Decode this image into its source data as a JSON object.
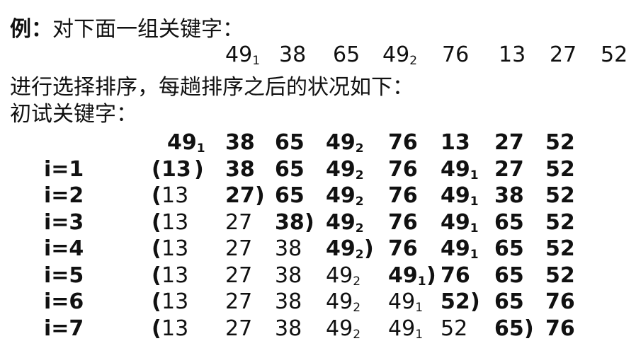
{
  "intro": {
    "bold": "例：",
    "text": "对下面一组关键字："
  },
  "keys": [
    {
      "v": "49",
      "s": "1"
    },
    {
      "v": "38",
      "s": ""
    },
    {
      "v": "65",
      "s": ""
    },
    {
      "v": "49",
      "s": "2"
    },
    {
      "v": "76",
      "s": ""
    },
    {
      "v": "13",
      "s": ""
    },
    {
      "v": "27",
      "s": ""
    },
    {
      "v": "52",
      "s": ""
    }
  ],
  "line2": "进行选择排序，每趟排序之后的状况如下：",
  "line3": "初试关键字：",
  "rows": [
    {
      "label": "",
      "sorted": 0,
      "cells": [
        {
          "v": "49",
          "s": "1"
        },
        {
          "v": "38",
          "s": ""
        },
        {
          "v": "65",
          "s": ""
        },
        {
          "v": "49",
          "s": "2"
        },
        {
          "v": "76",
          "s": ""
        },
        {
          "v": "13",
          "s": ""
        },
        {
          "v": "27",
          "s": ""
        },
        {
          "v": "52",
          "s": ""
        }
      ]
    },
    {
      "label": "i=1",
      "sorted": 1,
      "cells": [
        {
          "v": "13",
          "s": ""
        },
        {
          "v": "38",
          "s": ""
        },
        {
          "v": "65",
          "s": ""
        },
        {
          "v": "49",
          "s": "2"
        },
        {
          "v": "76",
          "s": ""
        },
        {
          "v": "49",
          "s": "1"
        },
        {
          "v": "27",
          "s": ""
        },
        {
          "v": "52",
          "s": ""
        }
      ]
    },
    {
      "label": "i=2",
      "sorted": 2,
      "cells": [
        {
          "v": "13",
          "s": ""
        },
        {
          "v": "27",
          "s": ""
        },
        {
          "v": "65",
          "s": ""
        },
        {
          "v": "49",
          "s": "2"
        },
        {
          "v": "76",
          "s": ""
        },
        {
          "v": "49",
          "s": "1"
        },
        {
          "v": "38",
          "s": ""
        },
        {
          "v": "52",
          "s": ""
        }
      ]
    },
    {
      "label": "i=3",
      "sorted": 3,
      "cells": [
        {
          "v": "13",
          "s": ""
        },
        {
          "v": "27",
          "s": ""
        },
        {
          "v": "38",
          "s": ""
        },
        {
          "v": "49",
          "s": "2"
        },
        {
          "v": "76",
          "s": ""
        },
        {
          "v": "49",
          "s": "1"
        },
        {
          "v": "65",
          "s": ""
        },
        {
          "v": "52",
          "s": ""
        }
      ]
    },
    {
      "label": "i=4",
      "sorted": 4,
      "cells": [
        {
          "v": "13",
          "s": ""
        },
        {
          "v": "27",
          "s": ""
        },
        {
          "v": "38",
          "s": ""
        },
        {
          "v": "49",
          "s": "2"
        },
        {
          "v": "76",
          "s": ""
        },
        {
          "v": "49",
          "s": "1"
        },
        {
          "v": "65",
          "s": ""
        },
        {
          "v": "52",
          "s": ""
        }
      ]
    },
    {
      "label": "i=5",
      "sorted": 5,
      "cells": [
        {
          "v": "13",
          "s": ""
        },
        {
          "v": "27",
          "s": ""
        },
        {
          "v": "38",
          "s": ""
        },
        {
          "v": "49",
          "s": "2"
        },
        {
          "v": "49",
          "s": "1"
        },
        {
          "v": "76",
          "s": ""
        },
        {
          "v": "65",
          "s": ""
        },
        {
          "v": "52",
          "s": ""
        }
      ]
    },
    {
      "label": "i=6",
      "sorted": 6,
      "cells": [
        {
          "v": "13",
          "s": ""
        },
        {
          "v": "27",
          "s": ""
        },
        {
          "v": "38",
          "s": ""
        },
        {
          "v": "49",
          "s": "2"
        },
        {
          "v": "49",
          "s": "1"
        },
        {
          "v": "52",
          "s": ""
        },
        {
          "v": "65",
          "s": ""
        },
        {
          "v": "76",
          "s": ""
        }
      ]
    },
    {
      "label": "i=7",
      "sorted": 7,
      "cells": [
        {
          "v": "13",
          "s": ""
        },
        {
          "v": "27",
          "s": ""
        },
        {
          "v": "38",
          "s": ""
        },
        {
          "v": "49",
          "s": "2"
        },
        {
          "v": "49",
          "s": "1"
        },
        {
          "v": "52",
          "s": ""
        },
        {
          "v": "65",
          "s": ""
        },
        {
          "v": "76",
          "s": ""
        }
      ]
    }
  ]
}
